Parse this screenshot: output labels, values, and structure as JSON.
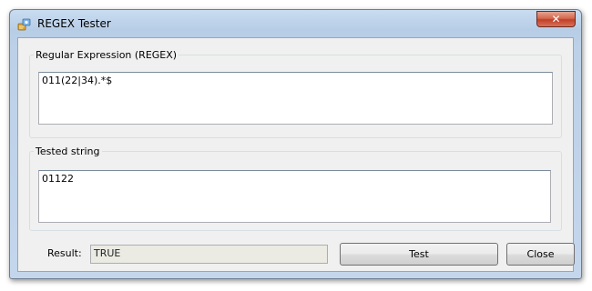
{
  "window": {
    "title": "REGEX Tester",
    "close_glyph": "✕"
  },
  "regex_group": {
    "legend": "Regular Expression (REGEX)",
    "value": "011(22|34).*$"
  },
  "tested_group": {
    "legend": "Tested string",
    "value": "01122"
  },
  "result": {
    "label": "Result:",
    "value": "TRUE"
  },
  "buttons": {
    "test_label": "Test",
    "close_label": "Close"
  },
  "icons": {
    "app": "regex-app-icon",
    "close": "close-icon"
  }
}
